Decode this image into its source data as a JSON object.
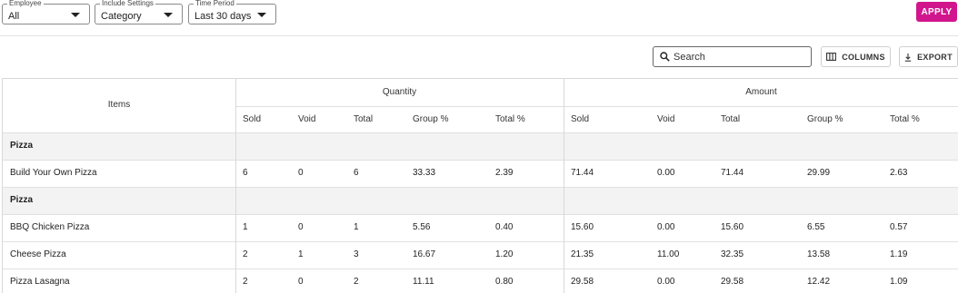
{
  "filters": {
    "employee": {
      "label": "Employee",
      "value": "All"
    },
    "include_settings": {
      "label": "Include Settings",
      "value": "Category"
    },
    "time_period": {
      "label": "Time Period",
      "value": "Last 30 days"
    }
  },
  "apply_label": "APPLY",
  "toolbar": {
    "search_placeholder": "Search",
    "columns_label": "COLUMNS",
    "export_label": "EXPORT"
  },
  "table": {
    "items_header": "Items",
    "quantity_header": "Quantity",
    "amount_header": "Amount",
    "quantity_columns": [
      "Sold",
      "Void",
      "Total",
      "Group %",
      "Total %"
    ],
    "amount_columns": [
      "Sold",
      "Void",
      "Total",
      "Group %",
      "Total %"
    ],
    "rows": [
      {
        "type": "group",
        "name": "Pizza"
      },
      {
        "type": "item",
        "name": "Build Your Own Pizza",
        "quantity": [
          "6",
          "0",
          "6",
          "33.33",
          "2.39"
        ],
        "amount": [
          "71.44",
          "0.00",
          "71.44",
          "29.99",
          "2.63"
        ]
      },
      {
        "type": "group",
        "name": "Pizza"
      },
      {
        "type": "item",
        "name": "BBQ Chicken Pizza",
        "quantity": [
          "1",
          "0",
          "1",
          "5.56",
          "0.40"
        ],
        "amount": [
          "15.60",
          "0.00",
          "15.60",
          "6.55",
          "0.57"
        ]
      },
      {
        "type": "item",
        "name": "Cheese Pizza",
        "quantity": [
          "2",
          "1",
          "3",
          "16.67",
          "1.20"
        ],
        "amount": [
          "21.35",
          "11.00",
          "32.35",
          "13.58",
          "1.19"
        ]
      },
      {
        "type": "item",
        "name": "Pizza Lasagna",
        "quantity": [
          "2",
          "0",
          "2",
          "11.11",
          "0.80"
        ],
        "amount": [
          "29.58",
          "0.00",
          "29.58",
          "12.42",
          "1.09"
        ]
      }
    ]
  },
  "colors": {
    "accent": "#d1168d",
    "group_row_bg": "#f3f3f3"
  }
}
